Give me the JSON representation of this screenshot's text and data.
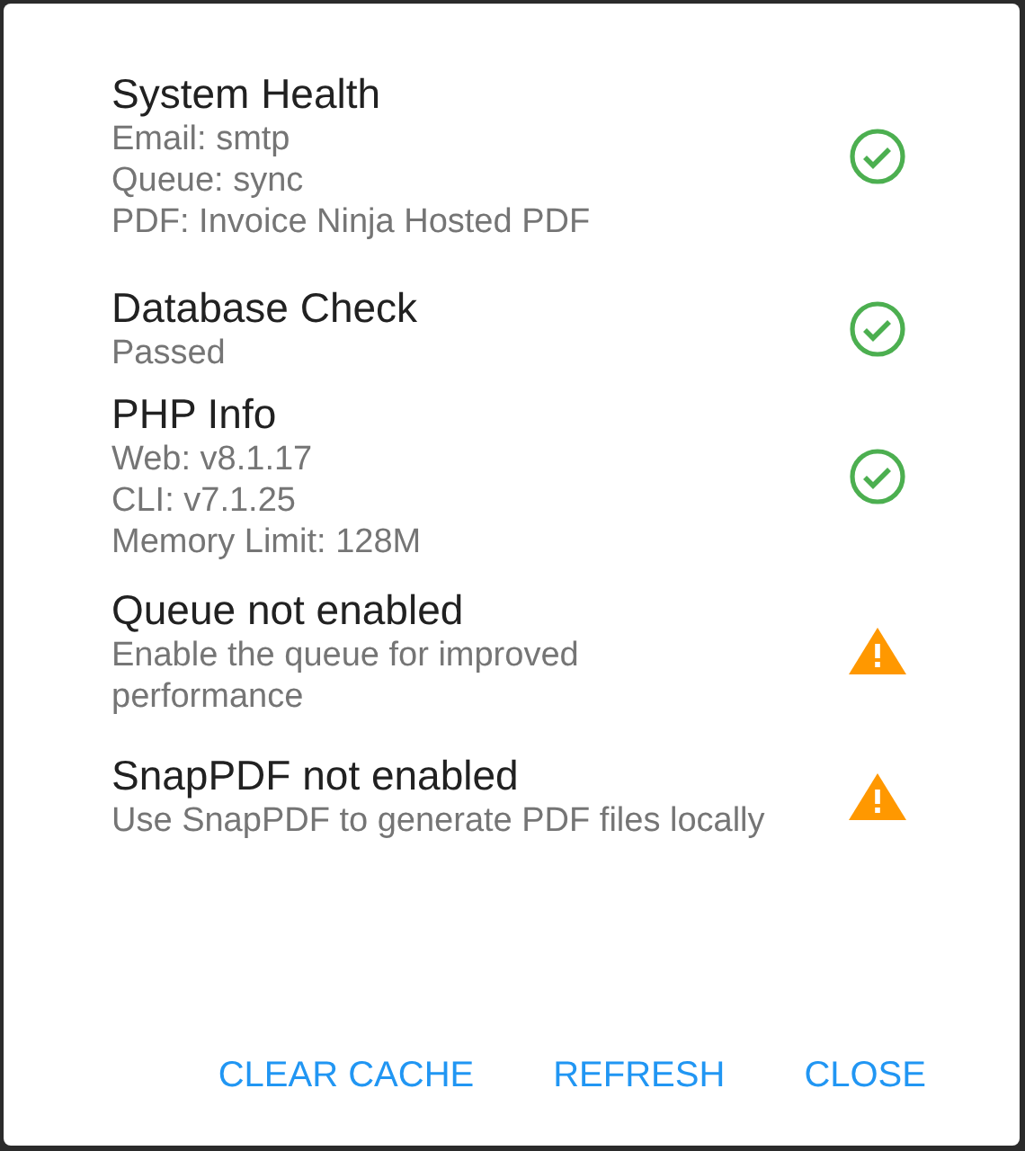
{
  "checks": [
    {
      "title": "System Health",
      "lines": [
        "Email: smtp",
        "Queue: sync",
        "PDF: Invoice Ninja Hosted PDF"
      ],
      "kind": "ok"
    },
    {
      "title": "Database Check",
      "lines": [
        "Passed"
      ],
      "kind": "ok"
    },
    {
      "title": "PHP Info",
      "lines": [
        "Web: v8.1.17",
        "CLI: v7.1.25",
        "Memory Limit: 128M"
      ],
      "kind": "ok"
    },
    {
      "title": "Queue not enabled",
      "lines": [
        "Enable the queue for improved performance"
      ],
      "kind": "warning"
    },
    {
      "title": "SnapPDF not enabled",
      "lines": [
        "Use SnapPDF to generate PDF files locally"
      ],
      "kind": "warning"
    }
  ],
  "buttons": [
    "CLEAR CACHE",
    "REFRESH",
    "CLOSE"
  ]
}
